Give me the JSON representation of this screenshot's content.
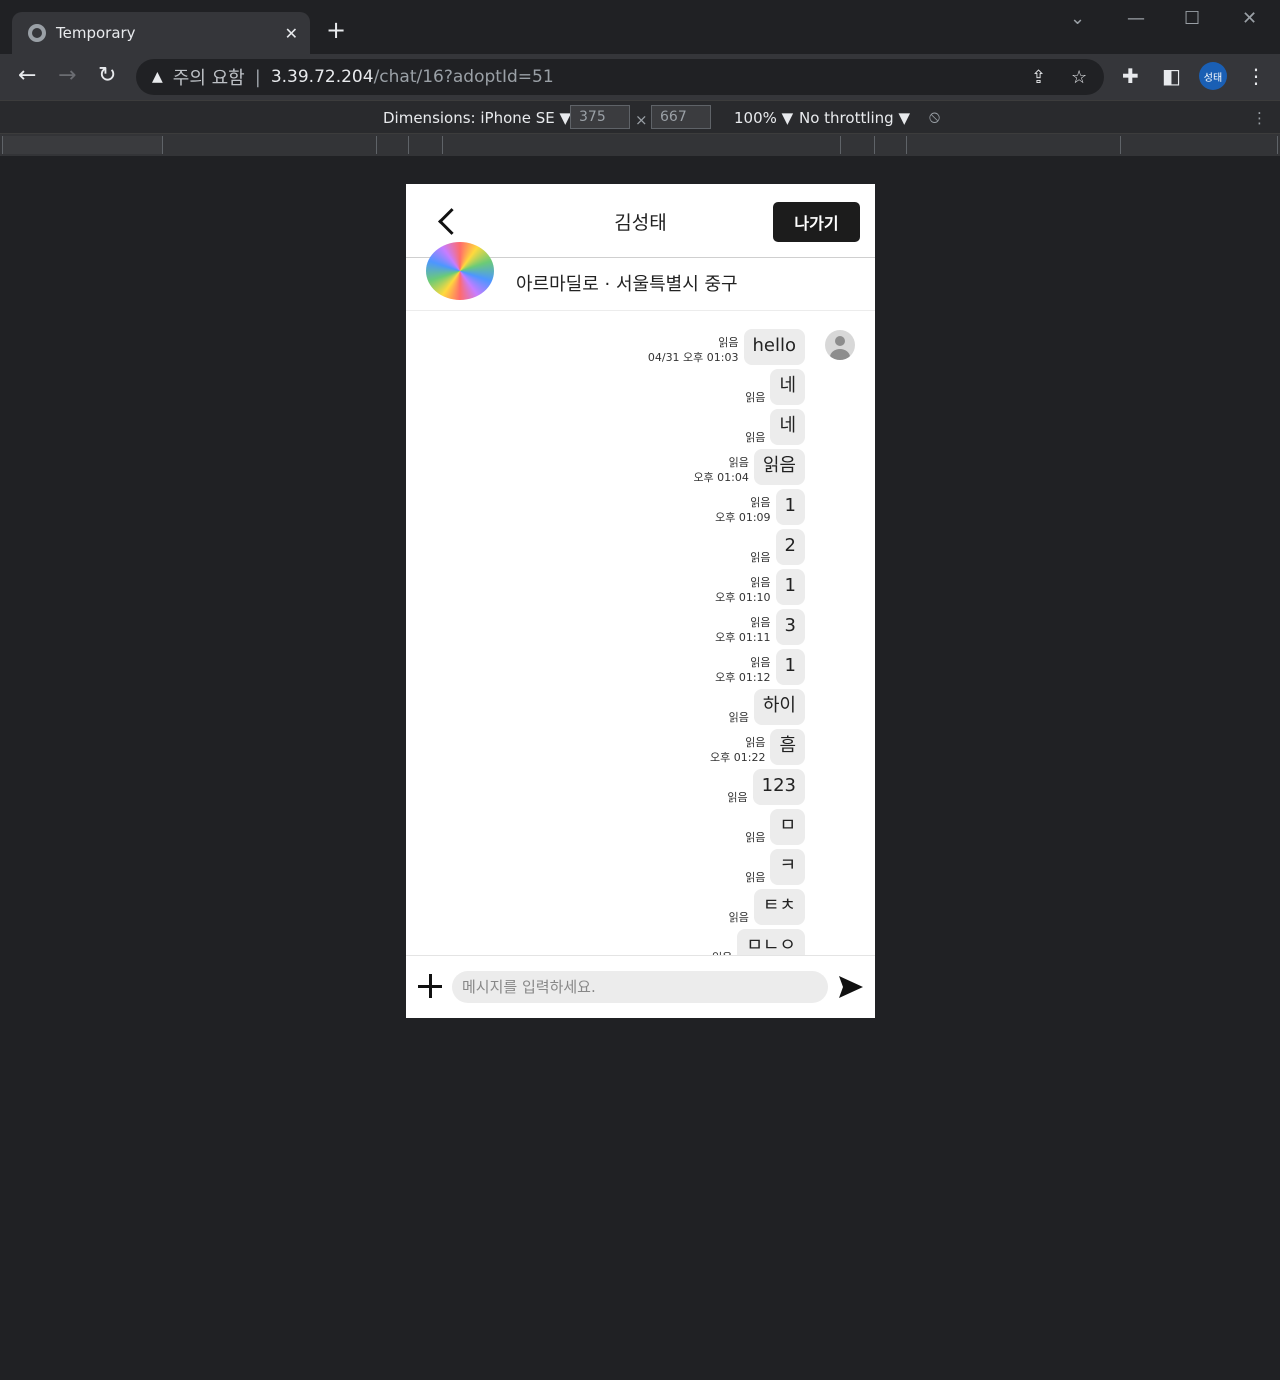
{
  "browser": {
    "tab_title": "Temporary",
    "tab_close": "✕",
    "new_tab": "+",
    "address_warning": "주의 요함",
    "address_host": "3.39.72.204",
    "address_path": "/chat/16?adoptId=51",
    "profile_label": "성태"
  },
  "devtools": {
    "dimensions_label": "Dimensions: iPhone SE ▼",
    "width": "375",
    "times": "×",
    "height": "667",
    "zoom": "100% ▼",
    "throttling": "No throttling ▼"
  },
  "chat": {
    "title": "김성태",
    "exit_label": "나가기",
    "place_name": "아르마딜로 · 서울특별시 중구",
    "input_placeholder": "메시지를 입력하세요.",
    "messages": [
      {
        "text": "hello",
        "read": "읽음",
        "time": "04/31 오후 01:03"
      },
      {
        "text": "네",
        "read": "읽음",
        "time": ""
      },
      {
        "text": "네",
        "read": "읽음",
        "time": ""
      },
      {
        "text": "읽음",
        "read": "읽음",
        "time": "오후 01:04"
      },
      {
        "text": "1",
        "read": "읽음",
        "time": "오후 01:09"
      },
      {
        "text": "2",
        "read": "읽음",
        "time": ""
      },
      {
        "text": "1",
        "read": "읽음",
        "time": "오후 01:10"
      },
      {
        "text": "3",
        "read": "읽음",
        "time": "오후 01:11"
      },
      {
        "text": "1",
        "read": "읽음",
        "time": "오후 01:12"
      },
      {
        "text": "하이",
        "read": "읽음",
        "time": ""
      },
      {
        "text": "흠",
        "read": "읽음",
        "time": "오후 01:22"
      },
      {
        "text": "123",
        "read": "읽음",
        "time": ""
      },
      {
        "text": "ㅁ",
        "read": "읽음",
        "time": ""
      },
      {
        "text": "ㅋ",
        "read": "읽음",
        "time": ""
      },
      {
        "text": "ㅌㅊ",
        "read": "읽음",
        "time": ""
      },
      {
        "text": "ㅁㄴㅇ",
        "read": "읽음",
        "time": ""
      }
    ]
  }
}
